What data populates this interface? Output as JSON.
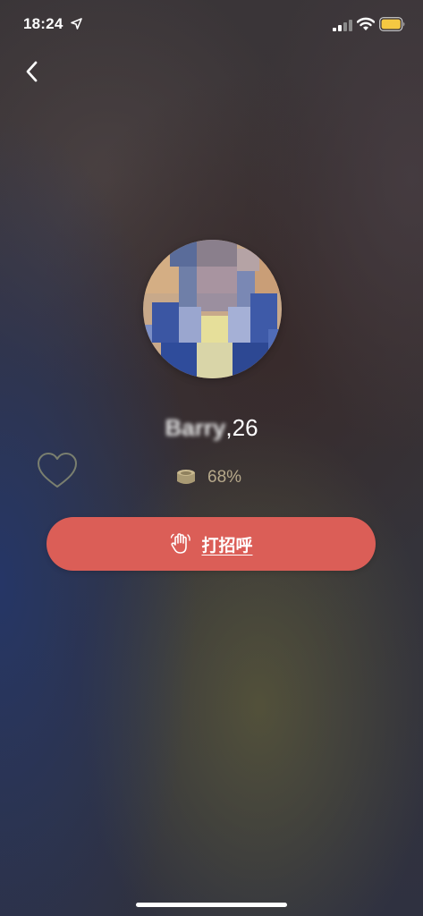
{
  "status_bar": {
    "time": "18:24",
    "icons": [
      "location-arrow-icon",
      "signal-icon",
      "wifi-icon",
      "battery-icon"
    ]
  },
  "navigation": {
    "back_icon": "chevron-left-icon"
  },
  "profile": {
    "name": "Barry",
    "age_suffix": ",26",
    "match_icon": "coin-stack-icon",
    "match_percent": "68%"
  },
  "actions": {
    "like_icon": "heart-outline-icon",
    "greet_icon": "waving-hand-icon",
    "greet_label": "打招呼"
  },
  "colors": {
    "greet_button": "#db5e57",
    "match_text": "#b7a98b",
    "battery_fill": "#f5c842"
  }
}
